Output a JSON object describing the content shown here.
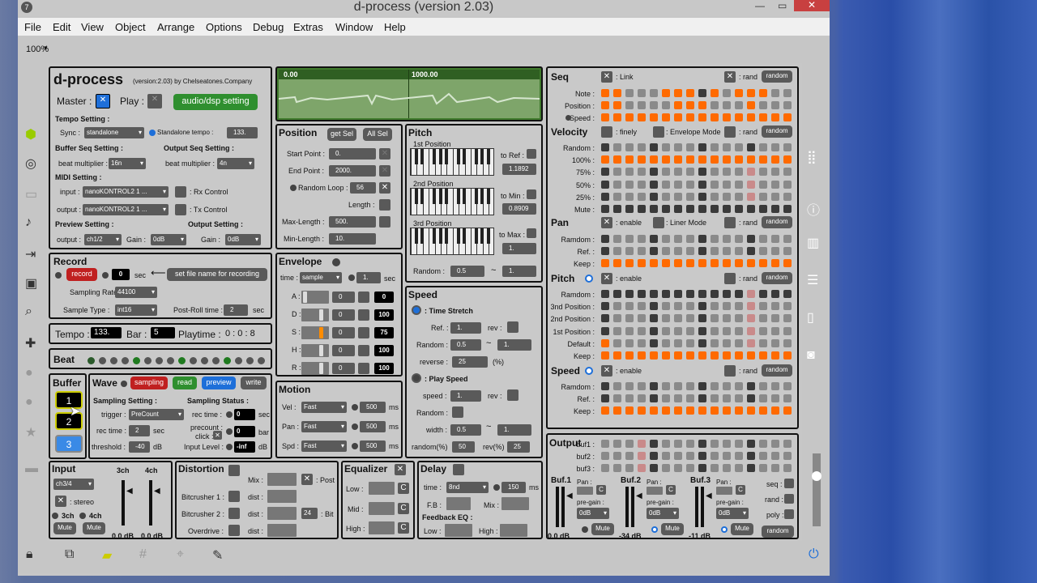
{
  "window": {
    "title": "d-process (version 2.03)",
    "zoom": "100%"
  },
  "menu": [
    "File",
    "Edit",
    "View",
    "Object",
    "Arrange",
    "Options",
    "Debug",
    "Extras",
    "Window",
    "Help"
  ],
  "header": {
    "title": "d-process",
    "subtitle": "(version:2.03) by Chelseatones.Company",
    "master": "Master :",
    "play": "Play :",
    "audio_btn": "audio/dsp setting"
  },
  "tempo_setting": {
    "label": "Tempo Setting :",
    "sync_label": "Sync :",
    "sync_value": "standalone",
    "standalone_tempo": "Standalone tempo :",
    "tempo_value": "133."
  },
  "buffer_seq": {
    "label": "Buffer Seq Setting :",
    "beat_mult": "beat multiplier :",
    "value": "16n"
  },
  "output_seq": {
    "label": "Output Seq Setting :",
    "beat_mult": "beat multiplier :",
    "value": "4n"
  },
  "midi": {
    "label": "MIDI Setting :",
    "input_label": "input :",
    "input_value": "nanoKONTROL2 1 ...",
    "output_label": "output :",
    "output_value": "nanoKONTROL2 1 ...",
    "rx": ": Rx Control",
    "tx": ": Tx Control"
  },
  "preview": {
    "label": "Preview Setting :",
    "output_label": "output :",
    "output_value": "ch1/2",
    "gain_label": "Gain :",
    "gain_value": "0dB"
  },
  "output_setting": {
    "label": "Output Setting :",
    "gain_label": "Gain :",
    "gain_value": "0dB"
  },
  "record": {
    "title": "Record",
    "record_btn": "record",
    "sec_value": "0",
    "sec": "sec",
    "setfile": "set file name for recording",
    "rate_label": "Sampling Rate :",
    "rate_value": "44100",
    "type_label": "Sample Type :",
    "type_value": "int16",
    "postroll_label": "Post-Roll time :",
    "postroll_value": "2",
    "postroll_unit": "sec"
  },
  "status": {
    "tempo_label": "Tempo :",
    "tempo": "133.",
    "bar_label": "Bar :",
    "bar": "5",
    "playtime_label": "Playtime :",
    "playtime": "0 : 0 : 8"
  },
  "beat": {
    "label": "Beat"
  },
  "buffer": {
    "label": "Buffer",
    "b1": "1",
    "b2": "2",
    "b3": "3"
  },
  "wave": {
    "label": "Wave",
    "sampling_btn": "sampling",
    "read_btn": "read",
    "preview_btn": "preview",
    "write_btn": "write",
    "sampling_setting": "Sampling Setting :",
    "trigger_label": "trigger :",
    "trigger_value": "PreCount",
    "rec_time_label": "rec time :",
    "rec_time_value": "2",
    "sec": "sec",
    "threshold_label": "threshold :",
    "threshold_value": "-40",
    "db": "dB",
    "status_label": "Sampling Status :",
    "st_rec_time": "rec time :",
    "st_rec_value": "0",
    "st_sec": "sec",
    "precount": "precount :",
    "click": "click :",
    "precount_value": "0",
    "bar": "bar",
    "input_level": "Input Level :",
    "input_level_value": "-inf",
    "st_db": "dB"
  },
  "input": {
    "label": "Input",
    "ch3": "3ch",
    "ch4": "4ch",
    "select": "ch3/4",
    "stereo": ": stereo",
    "r3": "3ch",
    "r4": "4ch",
    "mute1": "Mute",
    "mute2": "Mute",
    "db1": "0.0 dB",
    "db2": "0.0 dB"
  },
  "waveform": {
    "t0": "0.00",
    "t1": "1000.00"
  },
  "position": {
    "title": "Position",
    "getsel": "get Sel",
    "allsel": "All Sel",
    "start_label": "Start Point :",
    "start": "0.",
    "end_label": "End Point :",
    "end": "2000.",
    "random_loop": "Random Loop :",
    "random_loop_value": "56",
    "length": "Length :",
    "maxlen_label": "Max-Length :",
    "maxlen": "500.",
    "minlen_label": "Min-Length :",
    "minlen": "10."
  },
  "envelope": {
    "title": "Envelope",
    "time_label": "time :",
    "time_value": "sample",
    "time_num": "1.",
    "sec": "sec",
    "rows": [
      {
        "k": "A :",
        "v": "0",
        "n": "0"
      },
      {
        "k": "D :",
        "v": "0",
        "n": "100"
      },
      {
        "k": "S :",
        "v": "0",
        "n": "75"
      },
      {
        "k": "H :",
        "v": "0",
        "n": "100"
      },
      {
        "k": "R :",
        "v": "0",
        "n": "100"
      }
    ]
  },
  "motion": {
    "title": "Motion",
    "rows": [
      {
        "k": "Vel :",
        "v": "Fast",
        "n": "500",
        "u": "ms"
      },
      {
        "k": "Pan :",
        "v": "Fast",
        "n": "500",
        "u": "ms"
      },
      {
        "k": "Spd :",
        "v": "Fast",
        "n": "500",
        "u": "ms"
      }
    ]
  },
  "pitch": {
    "title": "Pitch",
    "p1": "1st Position",
    "p2": "2nd Position",
    "p3": "3rd Position",
    "toref": "to Ref :",
    "toref_v": "1.1892",
    "tomin": "to Min :",
    "tomin_v": "0.8909",
    "tomax": "to Max :",
    "tomax_v": "1.",
    "random": "Random :",
    "rand_a": "0.5",
    "tilde": "~",
    "rand_b": "1."
  },
  "speed": {
    "title": "Speed",
    "ts": ": Time Stretch",
    "ref": "Ref. :",
    "ref_v": "1.",
    "rev": "rev :",
    "random": "Random :",
    "rand_a": "0.5",
    "tilde": "~",
    "rand_b": "1.",
    "reverse": "reverse :",
    "reverse_v": "25",
    "pct": "(%)",
    "ps": ": Play Speed",
    "speed": "speed :",
    "speed_v": "1.",
    "rev2": "rev :",
    "random2": "Random :",
    "width": "width :",
    "width_a": "0.5",
    "tilde2": "~",
    "width_b": "1.",
    "randpct": "random(%)",
    "randpct_v": "50",
    "revpct": "rev(%)",
    "revpct_v": "25"
  },
  "distortion": {
    "title": "Distortion",
    "mix": "Mix :",
    "post": ": Post",
    "bc1": "Bitcrusher 1 :",
    "bc2": "Bitcrusher 2 :",
    "od": "Overdrive :",
    "dist": "dist :",
    "bit": "24",
    "bitl": ": Bit"
  },
  "equalizer": {
    "title": "Equalizer",
    "low": "Low :",
    "mid": "Mid :",
    "high": "High :",
    "c": "C"
  },
  "delay": {
    "title": "Delay",
    "time": "time :",
    "time_v": "8nd",
    "ms_v": "150",
    "ms": "ms",
    "fb": "F.B :",
    "mix": "Mix :",
    "feq": "Feedback EQ :",
    "low": "Low :",
    "high": "High :"
  },
  "seq": {
    "title": "Seq",
    "link": ": Link",
    "rand": ": rand",
    "random_btn": "random",
    "rows": [
      "Note :",
      "Position :",
      "Speed :"
    ]
  },
  "velocity": {
    "title": "Velocity",
    "finely": ": finely",
    "env_mode": ": Envelope Mode",
    "rand": ": rand",
    "random_btn": "random",
    "rows": [
      "Random :",
      "100% :",
      "75% :",
      "50% :",
      "25% :",
      "Mute :"
    ]
  },
  "pan": {
    "title": "Pan",
    "enable": ": enable",
    "liner": ": Liner Mode",
    "rand": ": rand",
    "random_btn": "random",
    "rows": [
      "Ramdom :",
      "Ref. :",
      "Keep :"
    ]
  },
  "pitchseq": {
    "title": "Pitch",
    "enable": ": enable",
    "rand": ": rand",
    "random_btn": "random",
    "rows": [
      "Ramdom :",
      "3nd Position :",
      "2nd Position :",
      "1st Position :",
      "Default :",
      "Keep :"
    ]
  },
  "speedseq": {
    "title": "Speed",
    "enable": ": enable",
    "rand": ": rand",
    "random_btn": "random",
    "rows": [
      "Ramdom :",
      "Ref. :",
      "Keep :"
    ]
  },
  "outputseq": {
    "title": "Output",
    "rows": [
      "buf1 :",
      "buf2 :",
      "buf3 :"
    ]
  },
  "outbuf": {
    "b1": "Buf.1",
    "b2": "Buf.2",
    "b3": "Buf.3",
    "pan": "Pan :",
    "c": "C",
    "pregain": "pre-gain :",
    "gain": "0dB",
    "mute": "Mute",
    "db1": "0.0 dB",
    "db2": "-34 dB",
    "db3": "-11 dB",
    "seq": "seq :",
    "rand": "rand :",
    "poly": "poly :",
    "random_btn": "random"
  },
  "colors": {
    "orange": "#ff6a00",
    "dark": "#3a3a3a",
    "grey": "#8a8a8a",
    "pink": "#c98a8a",
    "green": "#2f8f2f",
    "red": "#c02020",
    "blue": "#1e6fd9"
  }
}
